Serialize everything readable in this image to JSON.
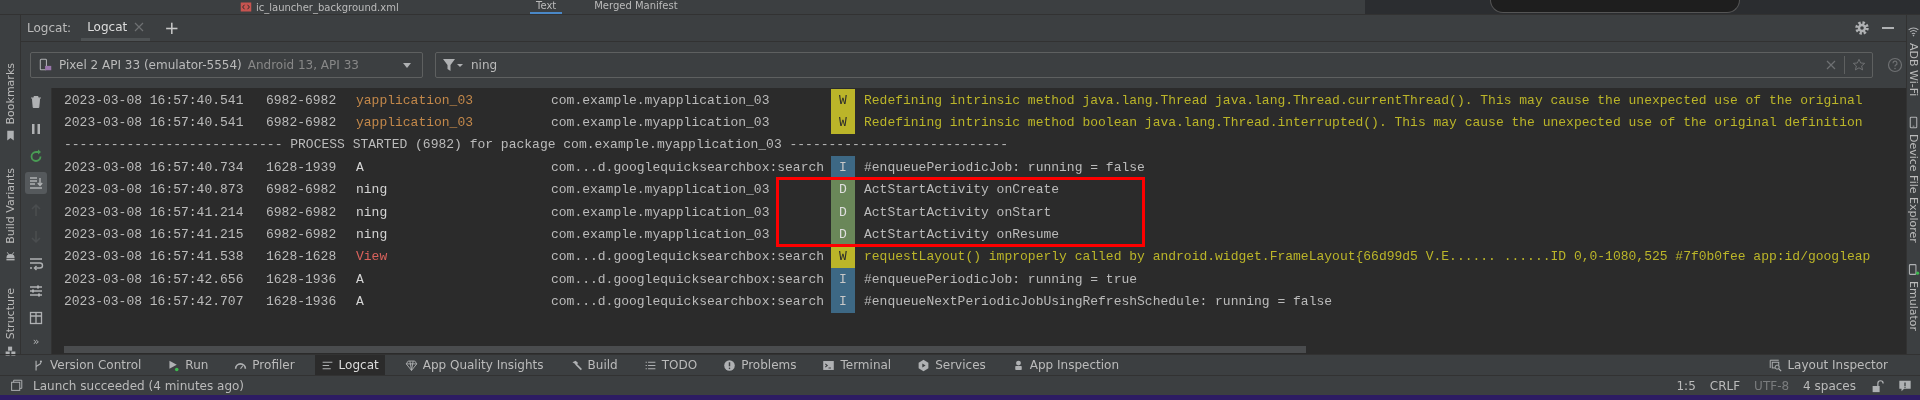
{
  "editor_strip": {
    "file": "ic_launcher_background.xml",
    "tabs": [
      {
        "label": "Text",
        "selected": true
      },
      {
        "label": "Merged Manifest",
        "selected": false
      }
    ]
  },
  "side_left": [
    {
      "label": "Bookmarks",
      "kind": "bookmark"
    },
    {
      "label": "Build Variants",
      "kind": "robot"
    },
    {
      "label": "Structure",
      "kind": "blocks"
    }
  ],
  "side_right": [
    {
      "label": "ADB Wi-Fi",
      "kind": "wifi"
    },
    {
      "label": "Device File Explorer",
      "kind": "phone"
    },
    {
      "label": "Emulator",
      "kind": "emulator"
    }
  ],
  "header": {
    "label": "Logcat:",
    "tabs": [
      {
        "label": "Logcat",
        "selected": true
      }
    ],
    "add": "+"
  },
  "device": {
    "name": "Pixel 2 API 33 (emulator-5554)",
    "detail": "Android 13, API 33"
  },
  "filter": {
    "value": "ning"
  },
  "tools": [
    {
      "kind": "trash",
      "on": false,
      "disabled": false
    },
    {
      "kind": "pause",
      "on": false,
      "disabled": false
    },
    {
      "kind": "restart",
      "on": false,
      "disabled": false
    },
    {
      "kind": "scrollend",
      "on": true,
      "disabled": false
    },
    {
      "kind": "up",
      "on": false,
      "disabled": true
    },
    {
      "kind": "down",
      "on": false,
      "disabled": true
    },
    {
      "kind": "wrap",
      "on": false,
      "disabled": false
    },
    {
      "kind": "sliders",
      "on": false,
      "disabled": false
    },
    {
      "kind": "layout",
      "on": false,
      "disabled": false
    }
  ],
  "more": "»",
  "rows": [
    {
      "kind": "warning",
      "date": "2023-03-08 16:57:40.541",
      "pid": "6982-6982",
      "tag": "yapplication_03",
      "color": "#c3884a",
      "package": "com.example.myapplication_03",
      "level": "W",
      "message": "Redefining intrinsic method java.lang.Thread java.lang.Thread.currentThread(). This may cause the unexpected use of the original"
    },
    {
      "kind": "warning",
      "date": "2023-03-08 16:57:40.541",
      "pid": "6982-6982",
      "tag": "yapplication_03",
      "color": "#c3884a",
      "package": "com.example.myapplication_03",
      "level": "W",
      "message": "Redefining intrinsic method boolean java.lang.Thread.interrupted(). This may cause the unexpected use of the original definition"
    },
    {
      "kind": "separator",
      "text": "---------------------------- PROCESS STARTED (6982) for package com.example.myapplication_03 ----------------------------"
    },
    {
      "kind": "info",
      "date": "2023-03-08 16:57:40.734",
      "pid": "1628-1939",
      "tag": "A",
      "color": "#d4d4d4",
      "package": "com...d.googlequicksearchbox:search",
      "level": "I",
      "message": "#enqueuePeriodicJob: running = false"
    },
    {
      "kind": "debug",
      "date": "2023-03-08 16:57:40.873",
      "pid": "6982-6982",
      "tag": "ning",
      "color": "#d4d4d4",
      "package": "com.example.myapplication_03",
      "level": "D",
      "message": "ActStartActivity onCreate"
    },
    {
      "kind": "debug",
      "date": "2023-03-08 16:57:41.214",
      "pid": "6982-6982",
      "tag": "ning",
      "color": "#d4d4d4",
      "package": "com.example.myapplication_03",
      "level": "D",
      "message": "ActStartActivity onStart"
    },
    {
      "kind": "debug",
      "date": "2023-03-08 16:57:41.215",
      "pid": "6982-6982",
      "tag": "ning",
      "color": "#d4d4d4",
      "package": "com.example.myapplication_03",
      "level": "D",
      "message": "ActStartActivity onResume"
    },
    {
      "kind": "warning",
      "date": "2023-03-08 16:57:41.538",
      "pid": "1628-1628",
      "tag": "View",
      "color": "#d9625c",
      "package": "com...d.googlequicksearchbox:search",
      "level": "W",
      "message": "requestLayout() improperly called by android.widget.FrameLayout{66d99d5 V.E...... ......ID 0,0-1080,525 #7f0b0fee app:id/googleap"
    },
    {
      "kind": "info",
      "date": "2023-03-08 16:57:42.656",
      "pid": "1628-1936",
      "tag": "A",
      "color": "#d4d4d4",
      "package": "com...d.googlequicksearchbox:search",
      "level": "I",
      "message": "#enqueuePeriodicJob: running = true"
    },
    {
      "kind": "info",
      "date": "2023-03-08 16:57:42.707",
      "pid": "1628-1936",
      "tag": "A",
      "color": "#d4d4d4",
      "package": "com...d.googlequicksearchbox:search",
      "level": "I",
      "message": "#enqueueNextPeriodicJobUsingRefreshSchedule: running = false"
    }
  ],
  "annotation": {
    "kind": "rectangle"
  },
  "bottom_tools": [
    {
      "label": "Version Control",
      "kind": "branch",
      "selected": false
    },
    {
      "label": "Run",
      "kind": "run",
      "selected": false
    },
    {
      "label": "Profiler",
      "kind": "gauge",
      "selected": false
    },
    {
      "label": "Logcat",
      "kind": "lines",
      "selected": true
    },
    {
      "label": "App Quality Insights",
      "kind": "diamond",
      "selected": false
    },
    {
      "label": "Build",
      "kind": "hammer",
      "selected": false
    },
    {
      "label": "TODO",
      "kind": "list",
      "selected": false
    },
    {
      "label": "Problems",
      "kind": "problems",
      "selected": false
    },
    {
      "label": "Terminal",
      "kind": "terminal",
      "selected": false
    },
    {
      "label": "Services",
      "kind": "services",
      "selected": false
    },
    {
      "label": "App Inspection",
      "kind": "inspect",
      "selected": false
    }
  ],
  "right_tool": "Layout Inspector",
  "status": {
    "message": "Launch succeeded (4 minutes ago)",
    "position": "1:5",
    "line_separator": "CRLF",
    "encoding": "UTF-8",
    "indent": "4 spaces"
  }
}
